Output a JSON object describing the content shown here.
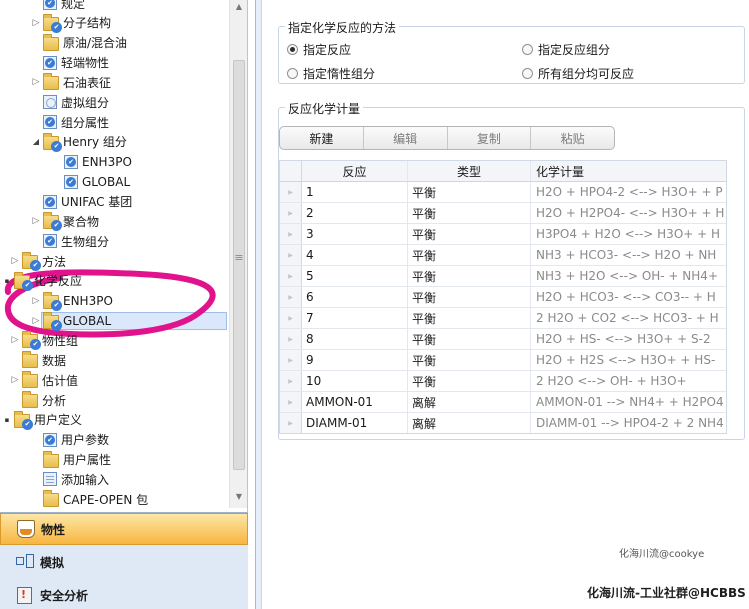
{
  "tree": {
    "items": [
      {
        "label": "规定",
        "icon": "form-check",
        "toggle": "none",
        "indent": 1
      },
      {
        "label": "分子结构",
        "icon": "folder-check",
        "toggle": "collapsed",
        "indent": 1
      },
      {
        "label": "原油/混合油",
        "icon": "folder",
        "toggle": "none",
        "indent": 1
      },
      {
        "label": "轻端物性",
        "icon": "form-check",
        "toggle": "none",
        "indent": 1
      },
      {
        "label": "石油表征",
        "icon": "folder",
        "toggle": "collapsed",
        "indent": 1
      },
      {
        "label": "虚拟组分",
        "icon": "form-blank",
        "toggle": "none",
        "indent": 1
      },
      {
        "label": "组分属性",
        "icon": "form-check",
        "toggle": "none",
        "indent": 1
      },
      {
        "label": "Henry 组分",
        "icon": "folder-check",
        "toggle": "expanded",
        "indent": 1
      },
      {
        "label": "ENH3PO",
        "icon": "form-check",
        "toggle": "none",
        "indent": 2
      },
      {
        "label": "GLOBAL",
        "icon": "form-check",
        "toggle": "none",
        "indent": 2
      },
      {
        "label": "UNIFAC 基团",
        "icon": "form-check",
        "toggle": "none",
        "indent": 1
      },
      {
        "label": "聚合物",
        "icon": "folder-check",
        "toggle": "collapsed",
        "indent": 1
      },
      {
        "label": "生物组分",
        "icon": "form-check",
        "toggle": "none",
        "indent": 1
      },
      {
        "label": "方法",
        "icon": "folder-check",
        "toggle": "collapsed",
        "indent": 0
      },
      {
        "label": "化学反应",
        "icon": "folder-check",
        "toggle": "expanded",
        "indent": 0
      },
      {
        "label": "ENH3PO",
        "icon": "folder-check",
        "toggle": "collapsed",
        "indent": 1
      },
      {
        "label": "GLOBAL",
        "icon": "folder-check",
        "toggle": "collapsed",
        "indent": 1,
        "selected": true
      },
      {
        "label": "物性组",
        "icon": "folder-check",
        "toggle": "collapsed",
        "indent": 0
      },
      {
        "label": "数据",
        "icon": "folder",
        "toggle": "none",
        "indent": 0
      },
      {
        "label": "估计值",
        "icon": "folder",
        "toggle": "collapsed",
        "indent": 0
      },
      {
        "label": "分析",
        "icon": "folder",
        "toggle": "none",
        "indent": 0
      },
      {
        "label": "用户定义",
        "icon": "folder-check",
        "toggle": "expanded",
        "indent": 0
      },
      {
        "label": "用户参数",
        "icon": "form-check",
        "toggle": "none",
        "indent": 1
      },
      {
        "label": "用户属性",
        "icon": "folder",
        "toggle": "none",
        "indent": 1
      },
      {
        "label": "添加输入",
        "icon": "form-doc",
        "toggle": "none",
        "indent": 1
      },
      {
        "label": "CAPE-OPEN 包",
        "icon": "folder",
        "toggle": "none",
        "indent": 1
      }
    ]
  },
  "nav": {
    "panes": [
      {
        "label": "物性",
        "icon": "flask-icon",
        "active": true
      },
      {
        "label": "模拟",
        "icon": "flowsheet-icon",
        "active": false
      },
      {
        "label": "安全分析",
        "icon": "safety-icon",
        "active": false
      }
    ]
  },
  "method_group": {
    "title": "指定化学反应的方法",
    "options": [
      {
        "label": "指定反应",
        "selected": true
      },
      {
        "label": "指定反应组分",
        "selected": false
      },
      {
        "label": "指定惰性组分",
        "selected": false
      },
      {
        "label": "所有组分均可反应",
        "selected": false
      }
    ]
  },
  "stoich_group": {
    "title": "反应化学计量",
    "toolbar": [
      {
        "label": "新建",
        "enabled": true
      },
      {
        "label": "编辑",
        "enabled": false
      },
      {
        "label": "复制",
        "enabled": false
      },
      {
        "label": "粘贴",
        "enabled": false
      }
    ],
    "columns": [
      "反应",
      "类型",
      "化学计量"
    ],
    "rows": [
      {
        "reaction": "1",
        "type": "平衡",
        "stoich": "H2O  +  HPO4-2  <-->  H3O+  +  P"
      },
      {
        "reaction": "2",
        "type": "平衡",
        "stoich": "H2O  +  H2PO4-  <-->  H3O+  +  H"
      },
      {
        "reaction": "3",
        "type": "平衡",
        "stoich": "H3PO4  +  H2O  <-->  H3O+  +  H"
      },
      {
        "reaction": "4",
        "type": "平衡",
        "stoich": "NH3  +  HCO3-  <-->  H2O  +  NH"
      },
      {
        "reaction": "5",
        "type": "平衡",
        "stoich": "NH3  +  H2O  <-->  OH-  +  NH4+"
      },
      {
        "reaction": "6",
        "type": "平衡",
        "stoich": "H2O  +  HCO3-  <-->  CO3--  +  H"
      },
      {
        "reaction": "7",
        "type": "平衡",
        "stoich": "2 H2O  +  CO2  <-->  HCO3-  +  H"
      },
      {
        "reaction": "8",
        "type": "平衡",
        "stoich": "H2O  +  HS-  <-->  H3O+  +  S-2"
      },
      {
        "reaction": "9",
        "type": "平衡",
        "stoich": "H2O  +  H2S  <-->  H3O+  +  HS-"
      },
      {
        "reaction": "10",
        "type": "平衡",
        "stoich": "2 H2O  <-->  OH-  +  H3O+"
      },
      {
        "reaction": "AMMON-01",
        "type": "离解",
        "stoich": "AMMON-01  -->  NH4+  +  H2PO4"
      },
      {
        "reaction": "DIAMM-01",
        "type": "离解",
        "stoich": "DIAMM-01  -->  HPO4-2  +  2 NH4"
      }
    ]
  },
  "watermarks": {
    "small": "化海川流@cookye",
    "footer": "化海川流-工业社群@HCBBS"
  },
  "annotation": {
    "color": "#e0138c"
  }
}
